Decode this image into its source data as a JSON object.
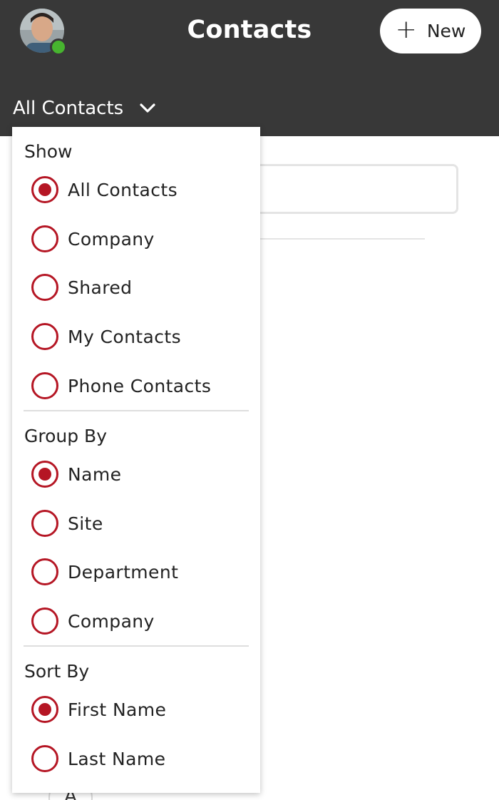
{
  "header": {
    "title": "Contacts",
    "new_button": {
      "icon": "plus-icon",
      "label": "New"
    },
    "filter_label": "All Contacts",
    "avatar": {
      "presence_color": "#47b42f"
    }
  },
  "background": {
    "search_placeholder": "",
    "index_letter": "A"
  },
  "dropdown": {
    "show": {
      "title": "Show",
      "options": [
        {
          "label": "All Contacts",
          "selected": true
        },
        {
          "label": "Company",
          "selected": false
        },
        {
          "label": "Shared",
          "selected": false
        },
        {
          "label": "My Contacts",
          "selected": false
        },
        {
          "label": "Phone Contacts",
          "selected": false
        }
      ]
    },
    "group_by": {
      "title": "Group By",
      "options": [
        {
          "label": "Name",
          "selected": true
        },
        {
          "label": "Site",
          "selected": false
        },
        {
          "label": "Department",
          "selected": false
        },
        {
          "label": "Company",
          "selected": false
        }
      ]
    },
    "sort_by": {
      "title": "Sort By",
      "options": [
        {
          "label": "First Name",
          "selected": true
        },
        {
          "label": "Last Name",
          "selected": false
        }
      ]
    }
  },
  "colors": {
    "header_bg": "#383838",
    "accent": "#b51624",
    "presence": "#47b42f"
  }
}
